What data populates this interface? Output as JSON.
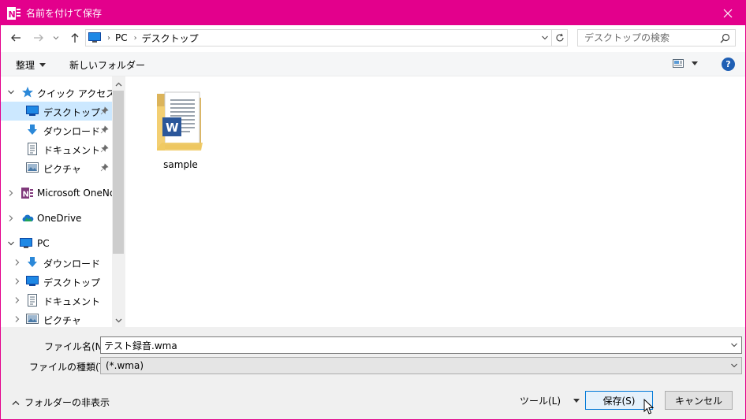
{
  "window": {
    "title": "名前を付けて保存",
    "accent_color": "#e3008c"
  },
  "address": {
    "segments": [
      "PC",
      "デスクトップ"
    ],
    "search_placeholder": "デスクトップの検索"
  },
  "toolbar": {
    "organize_label": "整理",
    "new_folder_label": "新しいフォルダー"
  },
  "nav": {
    "items": [
      {
        "label": "クイック アクセス",
        "icon": "star-icon"
      },
      {
        "label": "デスクトップ",
        "icon": "desktop-icon"
      },
      {
        "label": "ダウンロード",
        "icon": "download-icon"
      },
      {
        "label": "ドキュメント",
        "icon": "document-icon"
      },
      {
        "label": "ピクチャ",
        "icon": "picture-icon"
      },
      {
        "label": "Microsoft OneNote",
        "icon": "onenote-icon"
      },
      {
        "label": "OneDrive",
        "icon": "onedrive-icon"
      },
      {
        "label": "PC",
        "icon": "pc-icon"
      },
      {
        "label": "ダウンロード",
        "icon": "download-icon"
      },
      {
        "label": "デスクトップ",
        "icon": "desktop-icon"
      },
      {
        "label": "ドキュメント",
        "icon": "document-icon"
      },
      {
        "label": "ピクチャ",
        "icon": "picture-icon"
      }
    ]
  },
  "content": {
    "files": [
      {
        "name": "sample",
        "icon": "word-folder-icon"
      }
    ]
  },
  "form": {
    "filename_label": "ファイル名(N):",
    "filename_value": "テスト録音.wma",
    "filetype_label": "ファイルの種類(T):",
    "filetype_value": "(*.wma)"
  },
  "footer": {
    "hide_folders_label": "フォルダーの非表示",
    "tools_label": "ツール(L)",
    "save_label": "保存(S)",
    "cancel_label": "キャンセル"
  }
}
